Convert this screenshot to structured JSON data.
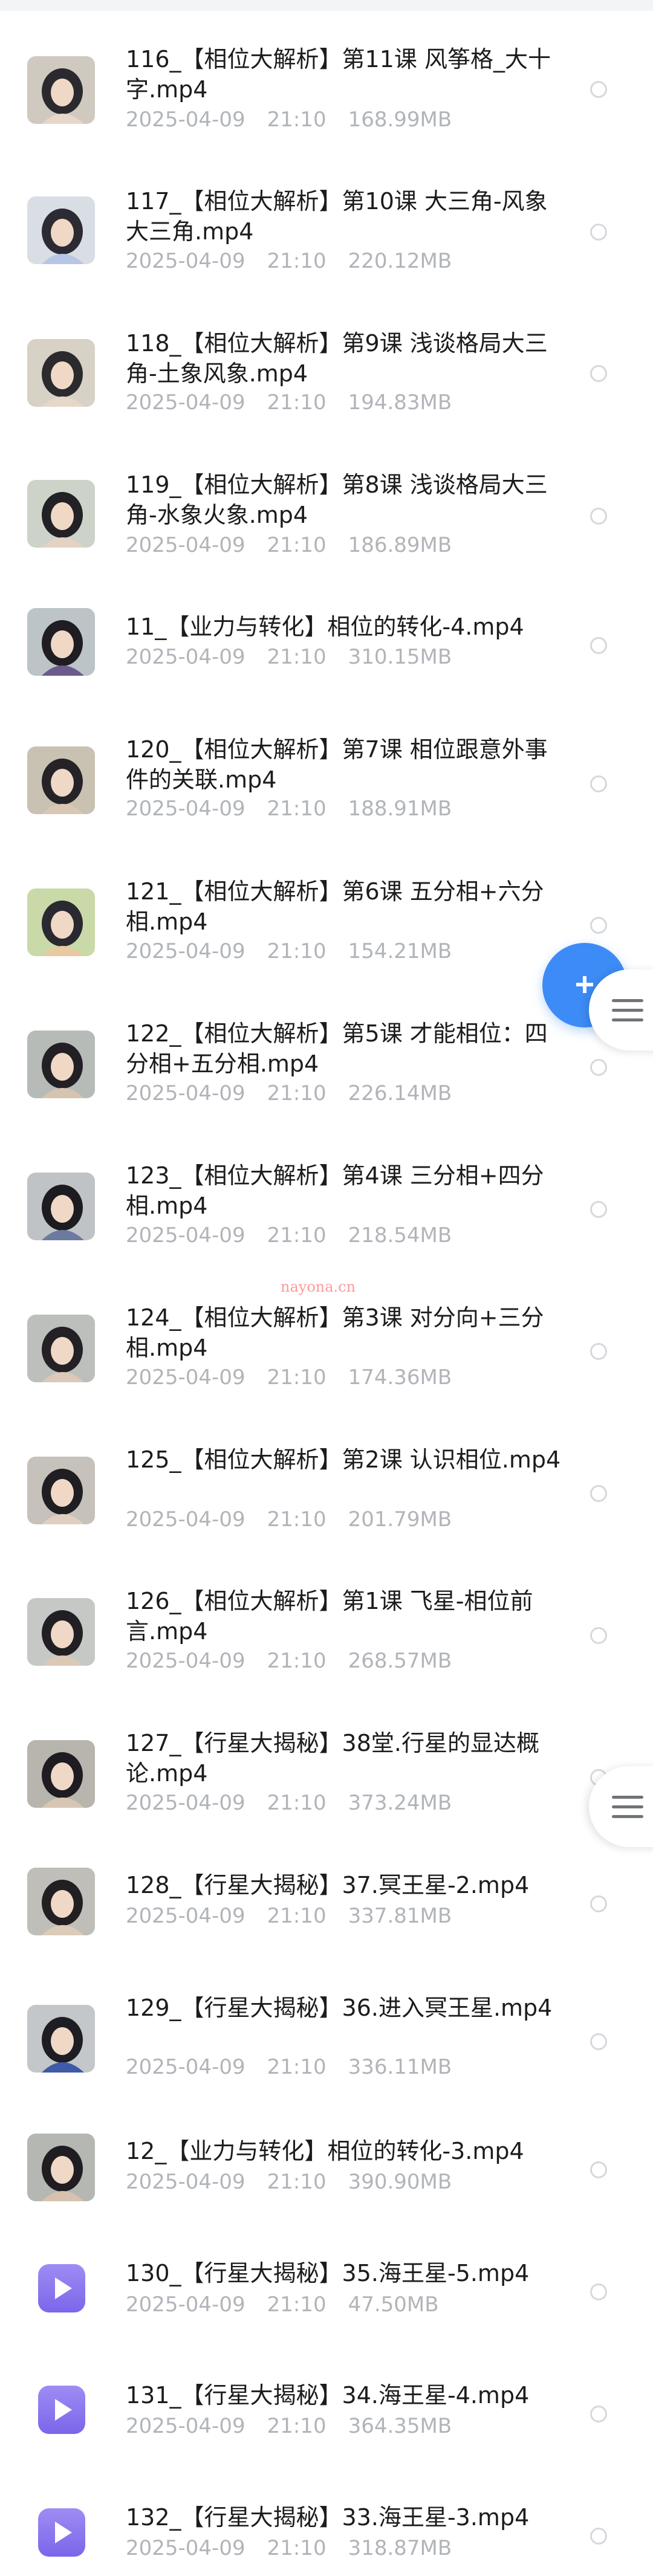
{
  "colors": {
    "accent": "#3d8bf6",
    "video_icon": "#8f7cf0",
    "meta_text": "#b1b4b9"
  },
  "watermark": "nayona.cn",
  "files": [
    {
      "title": "116_【相位大解析】第11课 风筝格_大十字.mp4",
      "date": "2025-04-09",
      "time": "21:10",
      "size": "168.99MB",
      "thumb": "video-thumbnail"
    },
    {
      "title": "117_【相位大解析】第10课 大三角-风象大三角.mp4",
      "date": "2025-04-09",
      "time": "21:10",
      "size": "220.12MB",
      "thumb": "video-thumbnail"
    },
    {
      "title": "118_【相位大解析】第9课 浅谈格局大三角-土象风象.mp4",
      "date": "2025-04-09",
      "time": "21:10",
      "size": "194.83MB",
      "thumb": "video-thumbnail"
    },
    {
      "title": "119_【相位大解析】第8课 浅谈格局大三角-水象火象.mp4",
      "date": "2025-04-09",
      "time": "21:10",
      "size": "186.89MB",
      "thumb": "video-thumbnail"
    },
    {
      "title": "11_【业力与转化】相位的转化-4.mp4",
      "date": "2025-04-09",
      "time": "21:10",
      "size": "310.15MB",
      "thumb": "video-thumbnail"
    },
    {
      "title": "120_【相位大解析】第7课 相位跟意外事件的关联.mp4",
      "date": "2025-04-09",
      "time": "21:10",
      "size": "188.91MB",
      "thumb": "video-thumbnail"
    },
    {
      "title": "121_【相位大解析】第6课 五分相+六分相.mp4",
      "date": "2025-04-09",
      "time": "21:10",
      "size": "154.21MB",
      "thumb": "video-thumbnail"
    },
    {
      "title": "122_【相位大解析】第5课 才能相位：四分相+五分相.mp4",
      "date": "2025-04-09",
      "time": "21:10",
      "size": "226.14MB",
      "thumb": "video-thumbnail"
    },
    {
      "title": "123_【相位大解析】第4课 三分相+四分相.mp4",
      "date": "2025-04-09",
      "time": "21:10",
      "size": "218.54MB",
      "thumb": "video-thumbnail"
    },
    {
      "title": "124_【相位大解析】第3课 对分向+三分相.mp4",
      "date": "2025-04-09",
      "time": "21:10",
      "size": "174.36MB",
      "thumb": "video-thumbnail"
    },
    {
      "title": "125_【相位大解析】第2课 认识相位.mp4",
      "date": "2025-04-09",
      "time": "21:10",
      "size": "201.79MB",
      "thumb": "video-thumbnail"
    },
    {
      "title": "126_【相位大解析】第1课 飞星-相位前言.mp4",
      "date": "2025-04-09",
      "time": "21:10",
      "size": "268.57MB",
      "thumb": "video-thumbnail"
    },
    {
      "title": "127_【行星大揭秘】38堂.行星的显达概论.mp4",
      "date": "2025-04-09",
      "time": "21:10",
      "size": "373.24MB",
      "thumb": "video-thumbnail"
    },
    {
      "title": "128_【行星大揭秘】37.冥王星-2.mp4",
      "date": "2025-04-09",
      "time": "21:10",
      "size": "337.81MB",
      "thumb": "video-thumbnail"
    },
    {
      "title": "129_【行星大揭秘】36.进入冥王星.mp4",
      "date": "2025-04-09",
      "time": "21:10",
      "size": "336.11MB",
      "thumb": "video-thumbnail"
    },
    {
      "title": "12_【业力与转化】相位的转化-3.mp4",
      "date": "2025-04-09",
      "time": "21:10",
      "size": "390.90MB",
      "thumb": "video-thumbnail"
    },
    {
      "title": "130_【行星大揭秘】35.海王星-5.mp4",
      "date": "2025-04-09",
      "time": "21:10",
      "size": "47.50MB",
      "thumb": "video-file-icon"
    },
    {
      "title": "131_【行星大揭秘】34.海王星-4.mp4",
      "date": "2025-04-09",
      "time": "21:10",
      "size": "364.35MB",
      "thumb": "video-file-icon"
    },
    {
      "title": "132_【行星大揭秘】33.海王星-3.mp4",
      "date": "2025-04-09",
      "time": "21:10",
      "size": "318.87MB",
      "thumb": "video-file-icon"
    }
  ],
  "icons": {
    "fab": "plus-icon",
    "side_handle": "menu-icon",
    "select": "radio-circle-icon",
    "video": "play-icon"
  }
}
